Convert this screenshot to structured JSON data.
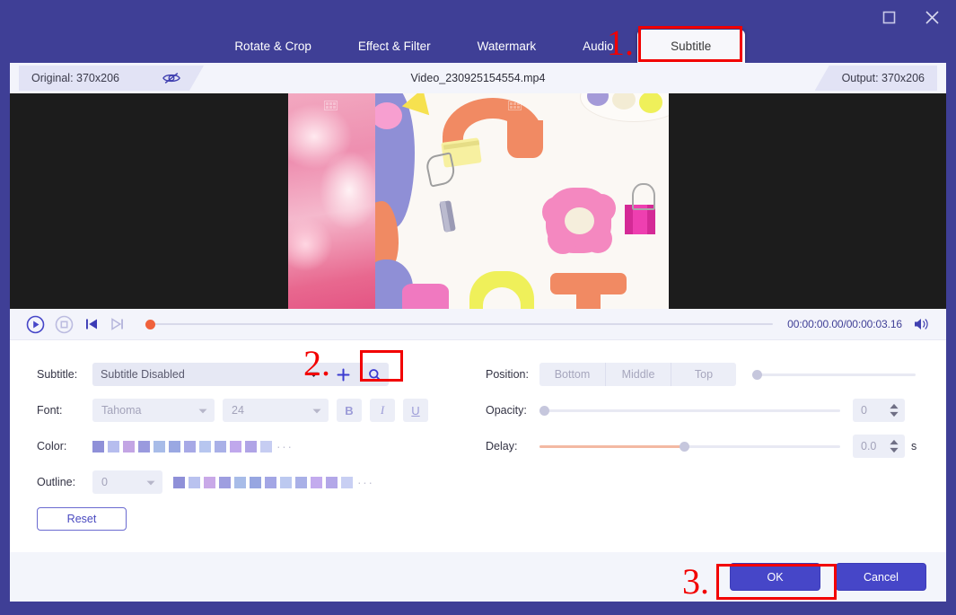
{
  "window": {
    "maximize_icon": "maximize-icon",
    "close_icon": "close-icon"
  },
  "tabs": [
    {
      "label": "Rotate & Crop",
      "active": false
    },
    {
      "label": "Effect & Filter",
      "active": false
    },
    {
      "label": "Watermark",
      "active": false
    },
    {
      "label": "Audio",
      "active": false
    },
    {
      "label": "Subtitle",
      "active": true
    }
  ],
  "annotations": [
    {
      "number": "1."
    },
    {
      "number": "2."
    },
    {
      "number": "3."
    }
  ],
  "infostrip": {
    "original_label": "Original: 370x206",
    "preview_toggle_icon": "eye-slash-icon",
    "filename": "Video_230925154554.mp4",
    "output_label": "Output: 370x206"
  },
  "playback": {
    "play_icon": "play-circle-icon",
    "stop_icon": "stop-circle-icon",
    "prev_frame_icon": "skip-previous-icon",
    "next_frame_icon": "skip-next-icon",
    "time": "00:00:00.00/00:00:03.16",
    "volume_icon": "volume-icon",
    "seek_percent": 0
  },
  "subtitle_row": {
    "label": "Subtitle:",
    "selected": "Subtitle Disabled",
    "caret_icon": "chevron-down-icon",
    "add_icon": "plus-icon",
    "search_icon": "search-icon"
  },
  "font_row": {
    "label": "Font:",
    "family": "Tahoma",
    "size": "24",
    "bold_label": "B",
    "italic_label": "I",
    "underline_label": "U"
  },
  "color_row": {
    "label": "Color:",
    "more_label": "···",
    "swatches": [
      "#8f90d8",
      "#b6bdee",
      "#c3a5e4",
      "#9a9ade",
      "#a8bce8",
      "#9aa8e2",
      "#a7a9e6",
      "#b7c6ef",
      "#a9b0e7",
      "#c0a8ec",
      "#b0a4e6",
      "#c6cdf2"
    ]
  },
  "outline_row": {
    "label": "Outline:",
    "width_value": "0",
    "caret_icon": "chevron-down-icon",
    "more_label": "···",
    "swatches": [
      "#8f90d8",
      "#b9c2ef",
      "#c9a9e8",
      "#9e9ee0",
      "#a8bce8",
      "#97a6e1",
      "#a3a6e5",
      "#bcc9f0",
      "#a9b0e7",
      "#c3abee",
      "#b3a7e8",
      "#c8cff3"
    ]
  },
  "reset_button": {
    "label": "Reset"
  },
  "position_row": {
    "label": "Position:",
    "options": [
      "Bottom",
      "Middle",
      "Top"
    ],
    "slider_percent": 0
  },
  "opacity_row": {
    "label": "Opacity:",
    "value": "0",
    "slider_percent": 0
  },
  "delay_row": {
    "label": "Delay:",
    "value": "0.0",
    "unit": "s",
    "slider_percent": 48
  },
  "footer": {
    "ok_label": "OK",
    "cancel_label": "Cancel"
  },
  "colors": {
    "brand": "#3f3f96",
    "accent": "#4646c8",
    "annotation": "#f20000",
    "panel": "#ffffff",
    "strip": "#f3f4fb"
  }
}
